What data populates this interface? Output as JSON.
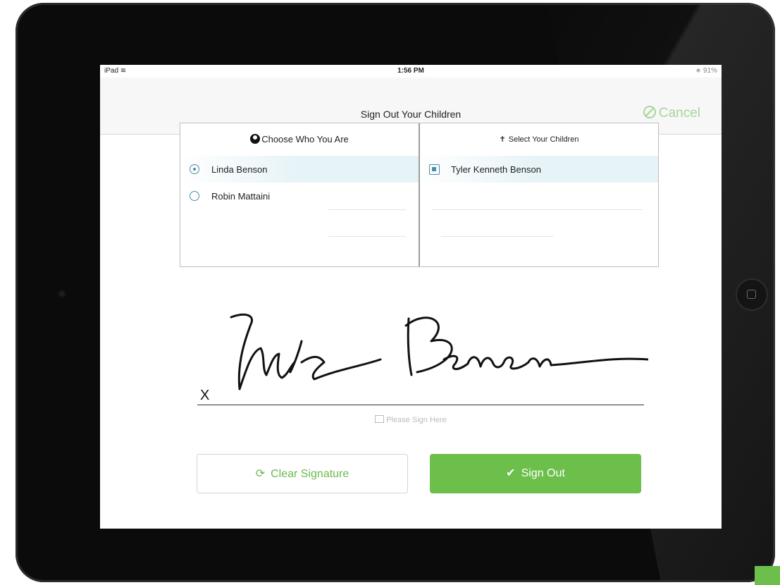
{
  "status_bar": {
    "carrier": "iPad",
    "wifi_icon": "wifi-icon",
    "time": "1:56 PM",
    "battery": "91%"
  },
  "nav": {
    "title": "Sign Out Your Children",
    "cancel_label": "Cancel",
    "cancel_icon": "cancel-circle-icon"
  },
  "guardians": {
    "header": "Choose Who You Are",
    "icon": "person-icon",
    "items": [
      {
        "label": "Linda Benson",
        "selected": true
      },
      {
        "label": "Robin Mattaini",
        "selected": false
      }
    ]
  },
  "children": {
    "header": "Select Your Children",
    "icon": "child-icon",
    "items": [
      {
        "label": "Tyler Kenneth Benson",
        "checked": true
      }
    ]
  },
  "signature": {
    "marker": "X",
    "hint": "Please Sign Here",
    "hint_icon": "pencil-icon"
  },
  "buttons": {
    "clear_label": "Clear Signature",
    "clear_icon": "refresh-icon",
    "signout_label": "Sign Out",
    "signout_icon": "checkmark-icon"
  },
  "colors": {
    "accent_green": "#6cbf4b",
    "cancel_green": "#a6d69a",
    "selection_blue": "#4a8ca8",
    "row_highlight": "#e6f3f7"
  }
}
